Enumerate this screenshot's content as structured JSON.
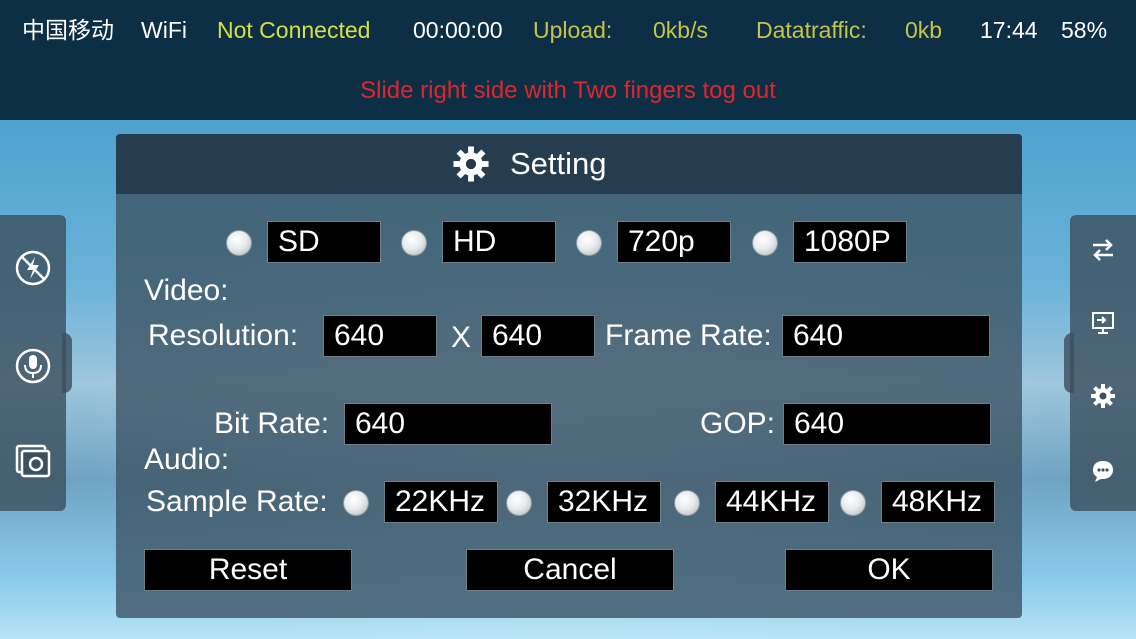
{
  "status_bar": {
    "carrier": "中国移动",
    "network": "WiFi",
    "connection": "Not Connected",
    "timer": "00:00:00",
    "upload_label": "Upload:",
    "upload_value": "0kb/s",
    "datatraffic_label": "Datatraffic:",
    "datatraffic_value": "0kb",
    "clock": "17:44",
    "battery": "58%",
    "hint": "Slide right side with Two fingers tog out"
  },
  "colors": {
    "status_bg": "#0c2f45",
    "connection_text": "#d6e045",
    "metric_text": "#c7c34a",
    "hint_text": "#e0262b"
  },
  "left_panel": {
    "icons": [
      "flash-off-icon",
      "microphone-icon",
      "photo-album-icon"
    ]
  },
  "right_panel": {
    "icons": [
      "swap-arrows-icon",
      "screen-share-icon",
      "gear-icon",
      "chat-bubble-icon"
    ]
  },
  "dialog": {
    "title": "Setting",
    "video": {
      "section_label": "Video:",
      "presets": [
        "SD",
        "HD",
        "720p",
        "1080P"
      ],
      "resolution_label": "Resolution:",
      "width": "640",
      "x_sep": "X",
      "height": "640",
      "frame_rate_label": "Frame Rate:",
      "frame_rate": "640",
      "bit_rate_label": "Bit Rate:",
      "bit_rate": "640",
      "gop_label": "GOP:",
      "gop": "640"
    },
    "audio": {
      "section_label": "Audio:",
      "sample_rate_label": "Sample Rate:",
      "rates": [
        "22KHz",
        "32KHz",
        "44KHz",
        "48KHz"
      ]
    },
    "buttons": {
      "reset": "Reset",
      "cancel": "Cancel",
      "ok": "OK"
    }
  }
}
